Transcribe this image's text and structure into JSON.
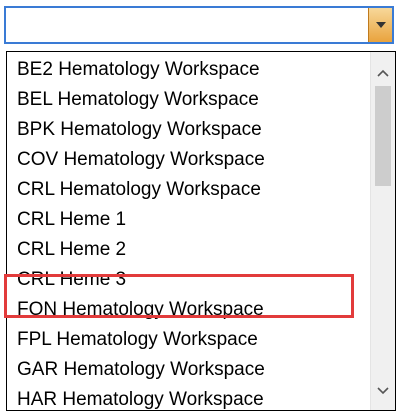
{
  "combo": {
    "value": ""
  },
  "list": {
    "items": [
      {
        "label": "BE2 Hematology Workspace"
      },
      {
        "label": "BEL Hematology Workspace"
      },
      {
        "label": "BPK Hematology Workspace"
      },
      {
        "label": "COV Hematology Workspace"
      },
      {
        "label": "CRL Hematology Workspace"
      },
      {
        "label": "CRL Heme 1"
      },
      {
        "label": "CRL Heme 2"
      },
      {
        "label": "CRL Heme 3"
      },
      {
        "label": "FON Hematology Workspace"
      },
      {
        "label": "FPL Hematology Workspace"
      },
      {
        "label": "GAR Hematology Workspace"
      },
      {
        "label": "HAR Hematology Workspace"
      }
    ]
  },
  "annotation": {
    "color": "#e23b3b"
  },
  "icons": {
    "dropdown_button": "chevron-down-icon",
    "scroll_up": "chevron-up-icon",
    "scroll_down": "chevron-down-icon"
  }
}
